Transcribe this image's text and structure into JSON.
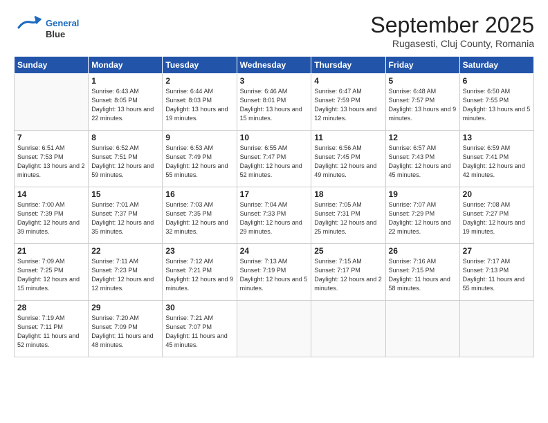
{
  "logo": {
    "line1": "General",
    "line2": "Blue"
  },
  "title": "September 2025",
  "subtitle": "Rugasesti, Cluj County, Romania",
  "days_of_week": [
    "Sunday",
    "Monday",
    "Tuesday",
    "Wednesday",
    "Thursday",
    "Friday",
    "Saturday"
  ],
  "weeks": [
    [
      {
        "day": "",
        "detail": ""
      },
      {
        "day": "1",
        "detail": "Sunrise: 6:43 AM\nSunset: 8:05 PM\nDaylight: 13 hours\nand 22 minutes."
      },
      {
        "day": "2",
        "detail": "Sunrise: 6:44 AM\nSunset: 8:03 PM\nDaylight: 13 hours\nand 19 minutes."
      },
      {
        "day": "3",
        "detail": "Sunrise: 6:46 AM\nSunset: 8:01 PM\nDaylight: 13 hours\nand 15 minutes."
      },
      {
        "day": "4",
        "detail": "Sunrise: 6:47 AM\nSunset: 7:59 PM\nDaylight: 13 hours\nand 12 minutes."
      },
      {
        "day": "5",
        "detail": "Sunrise: 6:48 AM\nSunset: 7:57 PM\nDaylight: 13 hours\nand 9 minutes."
      },
      {
        "day": "6",
        "detail": "Sunrise: 6:50 AM\nSunset: 7:55 PM\nDaylight: 13 hours\nand 5 minutes."
      }
    ],
    [
      {
        "day": "7",
        "detail": "Sunrise: 6:51 AM\nSunset: 7:53 PM\nDaylight: 13 hours\nand 2 minutes."
      },
      {
        "day": "8",
        "detail": "Sunrise: 6:52 AM\nSunset: 7:51 PM\nDaylight: 12 hours\nand 59 minutes."
      },
      {
        "day": "9",
        "detail": "Sunrise: 6:53 AM\nSunset: 7:49 PM\nDaylight: 12 hours\nand 55 minutes."
      },
      {
        "day": "10",
        "detail": "Sunrise: 6:55 AM\nSunset: 7:47 PM\nDaylight: 12 hours\nand 52 minutes."
      },
      {
        "day": "11",
        "detail": "Sunrise: 6:56 AM\nSunset: 7:45 PM\nDaylight: 12 hours\nand 49 minutes."
      },
      {
        "day": "12",
        "detail": "Sunrise: 6:57 AM\nSunset: 7:43 PM\nDaylight: 12 hours\nand 45 minutes."
      },
      {
        "day": "13",
        "detail": "Sunrise: 6:59 AM\nSunset: 7:41 PM\nDaylight: 12 hours\nand 42 minutes."
      }
    ],
    [
      {
        "day": "14",
        "detail": "Sunrise: 7:00 AM\nSunset: 7:39 PM\nDaylight: 12 hours\nand 39 minutes."
      },
      {
        "day": "15",
        "detail": "Sunrise: 7:01 AM\nSunset: 7:37 PM\nDaylight: 12 hours\nand 35 minutes."
      },
      {
        "day": "16",
        "detail": "Sunrise: 7:03 AM\nSunset: 7:35 PM\nDaylight: 12 hours\nand 32 minutes."
      },
      {
        "day": "17",
        "detail": "Sunrise: 7:04 AM\nSunset: 7:33 PM\nDaylight: 12 hours\nand 29 minutes."
      },
      {
        "day": "18",
        "detail": "Sunrise: 7:05 AM\nSunset: 7:31 PM\nDaylight: 12 hours\nand 25 minutes."
      },
      {
        "day": "19",
        "detail": "Sunrise: 7:07 AM\nSunset: 7:29 PM\nDaylight: 12 hours\nand 22 minutes."
      },
      {
        "day": "20",
        "detail": "Sunrise: 7:08 AM\nSunset: 7:27 PM\nDaylight: 12 hours\nand 19 minutes."
      }
    ],
    [
      {
        "day": "21",
        "detail": "Sunrise: 7:09 AM\nSunset: 7:25 PM\nDaylight: 12 hours\nand 15 minutes."
      },
      {
        "day": "22",
        "detail": "Sunrise: 7:11 AM\nSunset: 7:23 PM\nDaylight: 12 hours\nand 12 minutes."
      },
      {
        "day": "23",
        "detail": "Sunrise: 7:12 AM\nSunset: 7:21 PM\nDaylight: 12 hours\nand 9 minutes."
      },
      {
        "day": "24",
        "detail": "Sunrise: 7:13 AM\nSunset: 7:19 PM\nDaylight: 12 hours\nand 5 minutes."
      },
      {
        "day": "25",
        "detail": "Sunrise: 7:15 AM\nSunset: 7:17 PM\nDaylight: 12 hours\nand 2 minutes."
      },
      {
        "day": "26",
        "detail": "Sunrise: 7:16 AM\nSunset: 7:15 PM\nDaylight: 11 hours\nand 58 minutes."
      },
      {
        "day": "27",
        "detail": "Sunrise: 7:17 AM\nSunset: 7:13 PM\nDaylight: 11 hours\nand 55 minutes."
      }
    ],
    [
      {
        "day": "28",
        "detail": "Sunrise: 7:19 AM\nSunset: 7:11 PM\nDaylight: 11 hours\nand 52 minutes."
      },
      {
        "day": "29",
        "detail": "Sunrise: 7:20 AM\nSunset: 7:09 PM\nDaylight: 11 hours\nand 48 minutes."
      },
      {
        "day": "30",
        "detail": "Sunrise: 7:21 AM\nSunset: 7:07 PM\nDaylight: 11 hours\nand 45 minutes."
      },
      {
        "day": "",
        "detail": ""
      },
      {
        "day": "",
        "detail": ""
      },
      {
        "day": "",
        "detail": ""
      },
      {
        "day": "",
        "detail": ""
      }
    ]
  ]
}
